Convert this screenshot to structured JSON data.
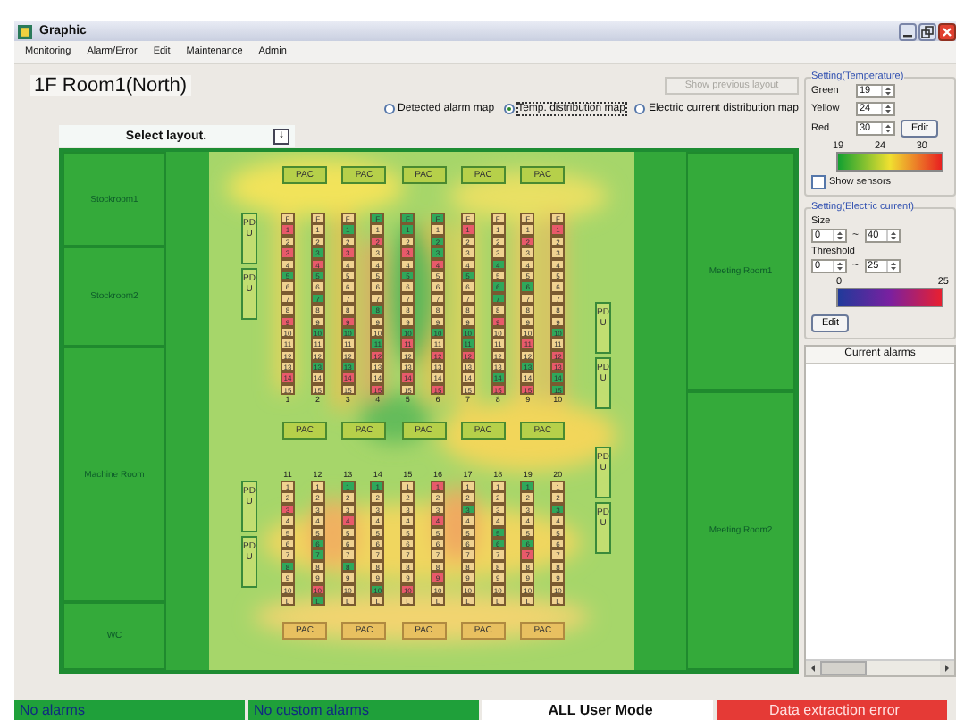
{
  "window": {
    "title": "Graphic"
  },
  "menu": [
    "Monitoring",
    "Alarm/Error",
    "Edit",
    "Maintenance",
    "Admin"
  ],
  "room_title": "1F Room1(North)",
  "show_previous_button": {
    "label": "Show previous layout",
    "disabled": true
  },
  "map_modes": [
    {
      "label": "Detected alarm map",
      "selected": false
    },
    {
      "label": "Temp. distribution map",
      "selected": true
    },
    {
      "label": "Electric current distribution map",
      "selected": false
    }
  ],
  "layout_select": {
    "label": "Select layout.",
    "button": "↓"
  },
  "floor": {
    "left_rooms": [
      "Stockroom1",
      "Stockroom2",
      "Machine Room",
      "WC"
    ],
    "right_rooms": [
      "Meeting Room1",
      "Meeting Room2"
    ],
    "pac_rows": [
      [
        "PAC",
        "PAC",
        "PAC",
        "PAC",
        "PAC"
      ],
      [
        "PAC",
        "PAC",
        "PAC",
        "PAC",
        "PAC"
      ],
      [
        "PAC",
        "PAC",
        "PAC",
        "PAC",
        "PAC"
      ]
    ],
    "pdus": [
      "PDU",
      "PDU",
      "PDU",
      "PDU",
      "PDU",
      "PDU",
      "PDU",
      "PDU"
    ],
    "rack_rows": [
      {
        "racks": [
          {
            "label": "1",
            "units": [
              {
                "label": "F",
                "color": "#f0d290"
              },
              {
                "label": "1",
                "color": "#e85a6a"
              },
              {
                "label": "2",
                "color": "#f0d290"
              },
              {
                "label": "3",
                "color": "#e85a6a"
              },
              {
                "label": "4",
                "color": "#f0d290"
              },
              {
                "label": "5",
                "color": "#2fa85a"
              },
              {
                "label": "6",
                "color": "#f0d290"
              },
              {
                "label": "7",
                "color": "#f0d290"
              },
              {
                "label": "8",
                "color": "#f0d290"
              },
              {
                "label": "9",
                "color": "#e85a6a"
              },
              {
                "label": "10",
                "color": "#f0d290"
              },
              {
                "label": "11",
                "color": "#f0d290"
              },
              {
                "label": "12",
                "color": "#f0d290"
              },
              {
                "label": "13",
                "color": "#f0d290"
              },
              {
                "label": "14",
                "color": "#e85a6a"
              },
              {
                "label": "15",
                "color": "#f0d290"
              }
            ]
          },
          {
            "label": "2",
            "units": [
              {
                "label": "F",
                "color": "#f0d290"
              },
              {
                "label": "1",
                "color": "#f0d290"
              },
              {
                "label": "2",
                "color": "#f0d290"
              },
              {
                "label": "3",
                "color": "#2fa85a"
              },
              {
                "label": "4",
                "color": "#e85a6a"
              },
              {
                "label": "5",
                "color": "#2fa85a"
              },
              {
                "label": "6",
                "color": "#f0d290"
              },
              {
                "label": "7",
                "color": "#2fa85a"
              },
              {
                "label": "8",
                "color": "#f0d290"
              },
              {
                "label": "9",
                "color": "#f0d290"
              },
              {
                "label": "10",
                "color": "#2fa85a"
              },
              {
                "label": "11",
                "color": "#f0d290"
              },
              {
                "label": "12",
                "color": "#f0d290"
              },
              {
                "label": "13",
                "color": "#2fa85a"
              },
              {
                "label": "14",
                "color": "#f0d290"
              },
              {
                "label": "15",
                "color": "#f0d290"
              }
            ]
          },
          {
            "label": "3",
            "units": [
              {
                "label": "F",
                "color": "#f0d290"
              },
              {
                "label": "1",
                "color": "#2fa85a"
              },
              {
                "label": "2",
                "color": "#f0d290"
              },
              {
                "label": "3",
                "color": "#e85a6a"
              },
              {
                "label": "4",
                "color": "#f0d290"
              },
              {
                "label": "5",
                "color": "#f0d290"
              },
              {
                "label": "6",
                "color": "#f0d290"
              },
              {
                "label": "7",
                "color": "#f0d290"
              },
              {
                "label": "8",
                "color": "#f0d290"
              },
              {
                "label": "9",
                "color": "#e85a6a"
              },
              {
                "label": "10",
                "color": "#2fa85a"
              },
              {
                "label": "11",
                "color": "#f0d290"
              },
              {
                "label": "12",
                "color": "#f0d290"
              },
              {
                "label": "13",
                "color": "#2fa85a"
              },
              {
                "label": "14",
                "color": "#e85a6a"
              },
              {
                "label": "15",
                "color": "#f0d290"
              }
            ]
          },
          {
            "label": "4",
            "units": [
              {
                "label": "F",
                "color": "#2fa85a"
              },
              {
                "label": "1",
                "color": "#f0d290"
              },
              {
                "label": "2",
                "color": "#e85a6a"
              },
              {
                "label": "3",
                "color": "#f0d290"
              },
              {
                "label": "4",
                "color": "#f0d290"
              },
              {
                "label": "5",
                "color": "#f0d290"
              },
              {
                "label": "6",
                "color": "#f0d290"
              },
              {
                "label": "7",
                "color": "#f0d290"
              },
              {
                "label": "8",
                "color": "#2fa85a"
              },
              {
                "label": "9",
                "color": "#f0d290"
              },
              {
                "label": "10",
                "color": "#f0d290"
              },
              {
                "label": "11",
                "color": "#2fa85a"
              },
              {
                "label": "12",
                "color": "#e85a6a"
              },
              {
                "label": "13",
                "color": "#f0d290"
              },
              {
                "label": "14",
                "color": "#f0d290"
              },
              {
                "label": "15",
                "color": "#e85a6a"
              }
            ]
          },
          {
            "label": "5",
            "units": [
              {
                "label": "F",
                "color": "#2fa85a"
              },
              {
                "label": "1",
                "color": "#2fa85a"
              },
              {
                "label": "2",
                "color": "#f0d290"
              },
              {
                "label": "3",
                "color": "#e85a6a"
              },
              {
                "label": "4",
                "color": "#f0d290"
              },
              {
                "label": "5",
                "color": "#2fa85a"
              },
              {
                "label": "6",
                "color": "#f0d290"
              },
              {
                "label": "7",
                "color": "#f0d290"
              },
              {
                "label": "8",
                "color": "#f0d290"
              },
              {
                "label": "9",
                "color": "#f0d290"
              },
              {
                "label": "10",
                "color": "#2fa85a"
              },
              {
                "label": "11",
                "color": "#e85a6a"
              },
              {
                "label": "12",
                "color": "#f0d290"
              },
              {
                "label": "13",
                "color": "#f0d290"
              },
              {
                "label": "14",
                "color": "#e85a6a"
              },
              {
                "label": "15",
                "color": "#f0d290"
              }
            ]
          },
          {
            "label": "6",
            "units": [
              {
                "label": "F",
                "color": "#2fa85a"
              },
              {
                "label": "1",
                "color": "#f0d290"
              },
              {
                "label": "2",
                "color": "#2fa85a"
              },
              {
                "label": "3",
                "color": "#2fa85a"
              },
              {
                "label": "4",
                "color": "#e85a6a"
              },
              {
                "label": "5",
                "color": "#f0d290"
              },
              {
                "label": "6",
                "color": "#f0d290"
              },
              {
                "label": "7",
                "color": "#f0d290"
              },
              {
                "label": "8",
                "color": "#f0d290"
              },
              {
                "label": "9",
                "color": "#f0d290"
              },
              {
                "label": "10",
                "color": "#2fa85a"
              },
              {
                "label": "11",
                "color": "#f0d290"
              },
              {
                "label": "12",
                "color": "#e85a6a"
              },
              {
                "label": "13",
                "color": "#f0d290"
              },
              {
                "label": "14",
                "color": "#f0d290"
              },
              {
                "label": "15",
                "color": "#e85a6a"
              }
            ]
          },
          {
            "label": "7",
            "units": [
              {
                "label": "F",
                "color": "#f0d290"
              },
              {
                "label": "1",
                "color": "#e85a6a"
              },
              {
                "label": "2",
                "color": "#f0d290"
              },
              {
                "label": "3",
                "color": "#f0d290"
              },
              {
                "label": "4",
                "color": "#f0d290"
              },
              {
                "label": "5",
                "color": "#2fa85a"
              },
              {
                "label": "6",
                "color": "#f0d290"
              },
              {
                "label": "7",
                "color": "#f0d290"
              },
              {
                "label": "8",
                "color": "#f0d290"
              },
              {
                "label": "9",
                "color": "#f0d290"
              },
              {
                "label": "10",
                "color": "#2fa85a"
              },
              {
                "label": "11",
                "color": "#2fa85a"
              },
              {
                "label": "12",
                "color": "#e85a6a"
              },
              {
                "label": "13",
                "color": "#f0d290"
              },
              {
                "label": "14",
                "color": "#f0d290"
              },
              {
                "label": "15",
                "color": "#f0d290"
              }
            ]
          },
          {
            "label": "8",
            "units": [
              {
                "label": "F",
                "color": "#f0d290"
              },
              {
                "label": "1",
                "color": "#f0d290"
              },
              {
                "label": "2",
                "color": "#f0d290"
              },
              {
                "label": "3",
                "color": "#f0d290"
              },
              {
                "label": "4",
                "color": "#2fa85a"
              },
              {
                "label": "5",
                "color": "#f0d290"
              },
              {
                "label": "6",
                "color": "#2fa85a"
              },
              {
                "label": "7",
                "color": "#2fa85a"
              },
              {
                "label": "8",
                "color": "#f0d290"
              },
              {
                "label": "9",
                "color": "#e85a6a"
              },
              {
                "label": "10",
                "color": "#f0d290"
              },
              {
                "label": "11",
                "color": "#f0d290"
              },
              {
                "label": "12",
                "color": "#f0d290"
              },
              {
                "label": "13",
                "color": "#f0d290"
              },
              {
                "label": "14",
                "color": "#2fa85a"
              },
              {
                "label": "15",
                "color": "#e85a6a"
              }
            ]
          },
          {
            "label": "9",
            "units": [
              {
                "label": "F",
                "color": "#f0d290"
              },
              {
                "label": "1",
                "color": "#f0d290"
              },
              {
                "label": "2",
                "color": "#e85a6a"
              },
              {
                "label": "3",
                "color": "#f0d290"
              },
              {
                "label": "4",
                "color": "#f0d290"
              },
              {
                "label": "5",
                "color": "#f0d290"
              },
              {
                "label": "6",
                "color": "#2fa85a"
              },
              {
                "label": "7",
                "color": "#f0d290"
              },
              {
                "label": "8",
                "color": "#f0d290"
              },
              {
                "label": "9",
                "color": "#f0d290"
              },
              {
                "label": "10",
                "color": "#f0d290"
              },
              {
                "label": "11",
                "color": "#e85a6a"
              },
              {
                "label": "12",
                "color": "#f0d290"
              },
              {
                "label": "13",
                "color": "#2fa85a"
              },
              {
                "label": "14",
                "color": "#f0d290"
              },
              {
                "label": "15",
                "color": "#e85a6a"
              }
            ]
          },
          {
            "label": "10",
            "units": [
              {
                "label": "F",
                "color": "#f0d290"
              },
              {
                "label": "1",
                "color": "#e85a6a"
              },
              {
                "label": "2",
                "color": "#f0d290"
              },
              {
                "label": "3",
                "color": "#f0d290"
              },
              {
                "label": "4",
                "color": "#f0d290"
              },
              {
                "label": "5",
                "color": "#f0d290"
              },
              {
                "label": "6",
                "color": "#f0d290"
              },
              {
                "label": "7",
                "color": "#f0d290"
              },
              {
                "label": "8",
                "color": "#f0d290"
              },
              {
                "label": "9",
                "color": "#f0d290"
              },
              {
                "label": "10",
                "color": "#2fa85a"
              },
              {
                "label": "11",
                "color": "#f0d290"
              },
              {
                "label": "12",
                "color": "#e85a6a"
              },
              {
                "label": "13",
                "color": "#e85a6a"
              },
              {
                "label": "14",
                "color": "#2fa85a"
              },
              {
                "label": "15",
                "color": "#2fa85a"
              }
            ]
          }
        ]
      },
      {
        "racks": [
          {
            "label": "11",
            "units": [
              {
                "label": "1",
                "color": "#f0d290"
              },
              {
                "label": "2",
                "color": "#f0d290"
              },
              {
                "label": "3",
                "color": "#e85a6a"
              },
              {
                "label": "4",
                "color": "#f0d290"
              },
              {
                "label": "5",
                "color": "#f0d290"
              },
              {
                "label": "6",
                "color": "#f0d290"
              },
              {
                "label": "7",
                "color": "#f0d290"
              },
              {
                "label": "8",
                "color": "#2fa85a"
              },
              {
                "label": "9",
                "color": "#f0d290"
              },
              {
                "label": "10",
                "color": "#f0d290"
              },
              {
                "label": "L",
                "color": "#f0d290"
              }
            ]
          },
          {
            "label": "12",
            "units": [
              {
                "label": "1",
                "color": "#f0d290"
              },
              {
                "label": "2",
                "color": "#f0d290"
              },
              {
                "label": "3",
                "color": "#f0d290"
              },
              {
                "label": "4",
                "color": "#f0d290"
              },
              {
                "label": "5",
                "color": "#f0d290"
              },
              {
                "label": "6",
                "color": "#2fa85a"
              },
              {
                "label": "7",
                "color": "#2fa85a"
              },
              {
                "label": "8",
                "color": "#f0d290"
              },
              {
                "label": "9",
                "color": "#f0d290"
              },
              {
                "label": "10",
                "color": "#e85a6a"
              },
              {
                "label": "L",
                "color": "#2fa85a"
              }
            ]
          },
          {
            "label": "13",
            "units": [
              {
                "label": "1",
                "color": "#2fa85a"
              },
              {
                "label": "2",
                "color": "#f0d290"
              },
              {
                "label": "3",
                "color": "#f0d290"
              },
              {
                "label": "4",
                "color": "#e85a6a"
              },
              {
                "label": "5",
                "color": "#f0d290"
              },
              {
                "label": "6",
                "color": "#f0d290"
              },
              {
                "label": "7",
                "color": "#f0d290"
              },
              {
                "label": "8",
                "color": "#2fa85a"
              },
              {
                "label": "9",
                "color": "#f0d290"
              },
              {
                "label": "10",
                "color": "#f0d290"
              },
              {
                "label": "L",
                "color": "#f0d290"
              }
            ]
          },
          {
            "label": "14",
            "units": [
              {
                "label": "1",
                "color": "#2fa85a"
              },
              {
                "label": "2",
                "color": "#f0d290"
              },
              {
                "label": "3",
                "color": "#f0d290"
              },
              {
                "label": "4",
                "color": "#f0d290"
              },
              {
                "label": "5",
                "color": "#f0d290"
              },
              {
                "label": "6",
                "color": "#f0d290"
              },
              {
                "label": "7",
                "color": "#f0d290"
              },
              {
                "label": "8",
                "color": "#f0d290"
              },
              {
                "label": "9",
                "color": "#f0d290"
              },
              {
                "label": "10",
                "color": "#2fa85a"
              },
              {
                "label": "L",
                "color": "#f0d290"
              }
            ]
          },
          {
            "label": "15",
            "units": [
              {
                "label": "1",
                "color": "#f0d290"
              },
              {
                "label": "2",
                "color": "#f0d290"
              },
              {
                "label": "3",
                "color": "#f0d290"
              },
              {
                "label": "4",
                "color": "#f0d290"
              },
              {
                "label": "5",
                "color": "#f0d290"
              },
              {
                "label": "6",
                "color": "#f0d290"
              },
              {
                "label": "7",
                "color": "#f0d290"
              },
              {
                "label": "8",
                "color": "#f0d290"
              },
              {
                "label": "9",
                "color": "#f0d290"
              },
              {
                "label": "10",
                "color": "#e85a6a"
              },
              {
                "label": "L",
                "color": "#f0d290"
              }
            ]
          },
          {
            "label": "16",
            "units": [
              {
                "label": "1",
                "color": "#e85a6a"
              },
              {
                "label": "2",
                "color": "#f0d290"
              },
              {
                "label": "3",
                "color": "#f0d290"
              },
              {
                "label": "4",
                "color": "#e85a6a"
              },
              {
                "label": "5",
                "color": "#f0d290"
              },
              {
                "label": "6",
                "color": "#f0d290"
              },
              {
                "label": "7",
                "color": "#f0d290"
              },
              {
                "label": "8",
                "color": "#f0d290"
              },
              {
                "label": "9",
                "color": "#e85a6a"
              },
              {
                "label": "10",
                "color": "#f0d290"
              },
              {
                "label": "L",
                "color": "#f0d290"
              }
            ]
          },
          {
            "label": "17",
            "units": [
              {
                "label": "1",
                "color": "#f0d290"
              },
              {
                "label": "2",
                "color": "#f0d290"
              },
              {
                "label": "3",
                "color": "#2fa85a"
              },
              {
                "label": "4",
                "color": "#f0d290"
              },
              {
                "label": "5",
                "color": "#f0d290"
              },
              {
                "label": "6",
                "color": "#f0d290"
              },
              {
                "label": "7",
                "color": "#f0d290"
              },
              {
                "label": "8",
                "color": "#f0d290"
              },
              {
                "label": "9",
                "color": "#f0d290"
              },
              {
                "label": "10",
                "color": "#f0d290"
              },
              {
                "label": "L",
                "color": "#f0d290"
              }
            ]
          },
          {
            "label": "18",
            "units": [
              {
                "label": "1",
                "color": "#f0d290"
              },
              {
                "label": "2",
                "color": "#f0d290"
              },
              {
                "label": "3",
                "color": "#f0d290"
              },
              {
                "label": "4",
                "color": "#f0d290"
              },
              {
                "label": "5",
                "color": "#2fa85a"
              },
              {
                "label": "6",
                "color": "#2fa85a"
              },
              {
                "label": "7",
                "color": "#f0d290"
              },
              {
                "label": "8",
                "color": "#f0d290"
              },
              {
                "label": "9",
                "color": "#f0d290"
              },
              {
                "label": "10",
                "color": "#f0d290"
              },
              {
                "label": "L",
                "color": "#f0d290"
              }
            ]
          },
          {
            "label": "19",
            "units": [
              {
                "label": "1",
                "color": "#2fa85a"
              },
              {
                "label": "2",
                "color": "#f0d290"
              },
              {
                "label": "3",
                "color": "#f0d290"
              },
              {
                "label": "4",
                "color": "#f0d290"
              },
              {
                "label": "5",
                "color": "#f0d290"
              },
              {
                "label": "6",
                "color": "#2fa85a"
              },
              {
                "label": "7",
                "color": "#e85a6a"
              },
              {
                "label": "8",
                "color": "#f0d290"
              },
              {
                "label": "9",
                "color": "#f0d290"
              },
              {
                "label": "10",
                "color": "#f0d290"
              },
              {
                "label": "L",
                "color": "#f0d290"
              }
            ]
          },
          {
            "label": "20",
            "units": [
              {
                "label": "1",
                "color": "#f0d290"
              },
              {
                "label": "2",
                "color": "#f0d290"
              },
              {
                "label": "3",
                "color": "#2fa85a"
              },
              {
                "label": "4",
                "color": "#f0d290"
              },
              {
                "label": "5",
                "color": "#f0d290"
              },
              {
                "label": "6",
                "color": "#f0d290"
              },
              {
                "label": "7",
                "color": "#f0d290"
              },
              {
                "label": "8",
                "color": "#f0d290"
              },
              {
                "label": "9",
                "color": "#f0d290"
              },
              {
                "label": "10",
                "color": "#f0d290"
              },
              {
                "label": "L",
                "color": "#f0d290"
              }
            ]
          }
        ]
      }
    ]
  },
  "temperature_settings": {
    "title": "Setting(Temperature)",
    "fields": [
      {
        "label": "Green",
        "value": "19"
      },
      {
        "label": "Yellow",
        "value": "24"
      },
      {
        "label": "Red",
        "value": "30"
      }
    ],
    "edit_button": "Edit",
    "scale_labels": [
      "19",
      "24",
      "30"
    ],
    "show_sensors": {
      "label": "Show sensors",
      "checked": false
    }
  },
  "current_settings": {
    "title": "Setting(Electric current)",
    "ranges": [
      {
        "label": "Size",
        "from": "0",
        "sep": "~",
        "to": "40"
      },
      {
        "label": "Threshold",
        "from": "0",
        "sep": "~",
        "to": "25"
      }
    ],
    "scale_labels": [
      "0",
      "25"
    ],
    "edit_button": "Edit"
  },
  "alarms_panel": {
    "title": "Current alarms"
  },
  "status_bar": [
    {
      "text": "No alarms",
      "kind": "ok"
    },
    {
      "text": "No custom alarms",
      "kind": "ok"
    },
    {
      "text": "ALL User Mode",
      "kind": "mode"
    },
    {
      "text": "Data extraction error",
      "kind": "error"
    }
  ]
}
